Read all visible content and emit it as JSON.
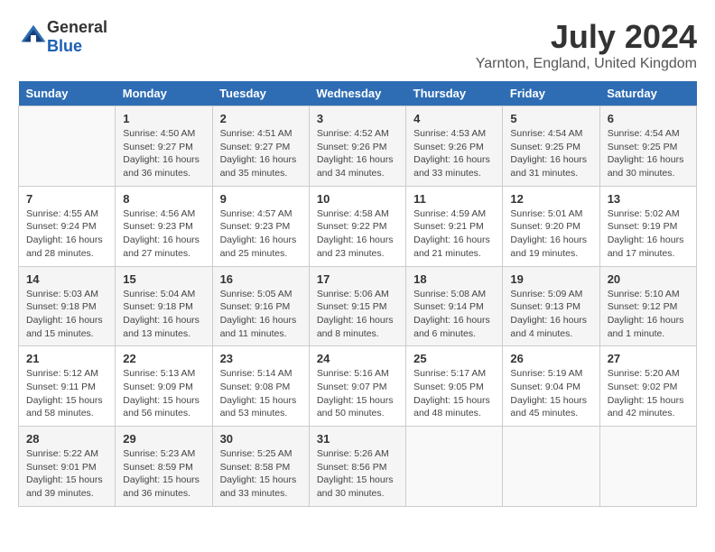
{
  "header": {
    "logo_general": "General",
    "logo_blue": "Blue",
    "title": "July 2024",
    "subtitle": "Yarnton, England, United Kingdom"
  },
  "days_of_week": [
    "Sunday",
    "Monday",
    "Tuesday",
    "Wednesday",
    "Thursday",
    "Friday",
    "Saturday"
  ],
  "weeks": [
    [
      {
        "day": "",
        "info": ""
      },
      {
        "day": "1",
        "info": "Sunrise: 4:50 AM\nSunset: 9:27 PM\nDaylight: 16 hours\nand 36 minutes."
      },
      {
        "day": "2",
        "info": "Sunrise: 4:51 AM\nSunset: 9:27 PM\nDaylight: 16 hours\nand 35 minutes."
      },
      {
        "day": "3",
        "info": "Sunrise: 4:52 AM\nSunset: 9:26 PM\nDaylight: 16 hours\nand 34 minutes."
      },
      {
        "day": "4",
        "info": "Sunrise: 4:53 AM\nSunset: 9:26 PM\nDaylight: 16 hours\nand 33 minutes."
      },
      {
        "day": "5",
        "info": "Sunrise: 4:54 AM\nSunset: 9:25 PM\nDaylight: 16 hours\nand 31 minutes."
      },
      {
        "day": "6",
        "info": "Sunrise: 4:54 AM\nSunset: 9:25 PM\nDaylight: 16 hours\nand 30 minutes."
      }
    ],
    [
      {
        "day": "7",
        "info": "Sunrise: 4:55 AM\nSunset: 9:24 PM\nDaylight: 16 hours\nand 28 minutes."
      },
      {
        "day": "8",
        "info": "Sunrise: 4:56 AM\nSunset: 9:23 PM\nDaylight: 16 hours\nand 27 minutes."
      },
      {
        "day": "9",
        "info": "Sunrise: 4:57 AM\nSunset: 9:23 PM\nDaylight: 16 hours\nand 25 minutes."
      },
      {
        "day": "10",
        "info": "Sunrise: 4:58 AM\nSunset: 9:22 PM\nDaylight: 16 hours\nand 23 minutes."
      },
      {
        "day": "11",
        "info": "Sunrise: 4:59 AM\nSunset: 9:21 PM\nDaylight: 16 hours\nand 21 minutes."
      },
      {
        "day": "12",
        "info": "Sunrise: 5:01 AM\nSunset: 9:20 PM\nDaylight: 16 hours\nand 19 minutes."
      },
      {
        "day": "13",
        "info": "Sunrise: 5:02 AM\nSunset: 9:19 PM\nDaylight: 16 hours\nand 17 minutes."
      }
    ],
    [
      {
        "day": "14",
        "info": "Sunrise: 5:03 AM\nSunset: 9:18 PM\nDaylight: 16 hours\nand 15 minutes."
      },
      {
        "day": "15",
        "info": "Sunrise: 5:04 AM\nSunset: 9:18 PM\nDaylight: 16 hours\nand 13 minutes."
      },
      {
        "day": "16",
        "info": "Sunrise: 5:05 AM\nSunset: 9:16 PM\nDaylight: 16 hours\nand 11 minutes."
      },
      {
        "day": "17",
        "info": "Sunrise: 5:06 AM\nSunset: 9:15 PM\nDaylight: 16 hours\nand 8 minutes."
      },
      {
        "day": "18",
        "info": "Sunrise: 5:08 AM\nSunset: 9:14 PM\nDaylight: 16 hours\nand 6 minutes."
      },
      {
        "day": "19",
        "info": "Sunrise: 5:09 AM\nSunset: 9:13 PM\nDaylight: 16 hours\nand 4 minutes."
      },
      {
        "day": "20",
        "info": "Sunrise: 5:10 AM\nSunset: 9:12 PM\nDaylight: 16 hours\nand 1 minute."
      }
    ],
    [
      {
        "day": "21",
        "info": "Sunrise: 5:12 AM\nSunset: 9:11 PM\nDaylight: 15 hours\nand 58 minutes."
      },
      {
        "day": "22",
        "info": "Sunrise: 5:13 AM\nSunset: 9:09 PM\nDaylight: 15 hours\nand 56 minutes."
      },
      {
        "day": "23",
        "info": "Sunrise: 5:14 AM\nSunset: 9:08 PM\nDaylight: 15 hours\nand 53 minutes."
      },
      {
        "day": "24",
        "info": "Sunrise: 5:16 AM\nSunset: 9:07 PM\nDaylight: 15 hours\nand 50 minutes."
      },
      {
        "day": "25",
        "info": "Sunrise: 5:17 AM\nSunset: 9:05 PM\nDaylight: 15 hours\nand 48 minutes."
      },
      {
        "day": "26",
        "info": "Sunrise: 5:19 AM\nSunset: 9:04 PM\nDaylight: 15 hours\nand 45 minutes."
      },
      {
        "day": "27",
        "info": "Sunrise: 5:20 AM\nSunset: 9:02 PM\nDaylight: 15 hours\nand 42 minutes."
      }
    ],
    [
      {
        "day": "28",
        "info": "Sunrise: 5:22 AM\nSunset: 9:01 PM\nDaylight: 15 hours\nand 39 minutes."
      },
      {
        "day": "29",
        "info": "Sunrise: 5:23 AM\nSunset: 8:59 PM\nDaylight: 15 hours\nand 36 minutes."
      },
      {
        "day": "30",
        "info": "Sunrise: 5:25 AM\nSunset: 8:58 PM\nDaylight: 15 hours\nand 33 minutes."
      },
      {
        "day": "31",
        "info": "Sunrise: 5:26 AM\nSunset: 8:56 PM\nDaylight: 15 hours\nand 30 minutes."
      },
      {
        "day": "",
        "info": ""
      },
      {
        "day": "",
        "info": ""
      },
      {
        "day": "",
        "info": ""
      }
    ]
  ]
}
